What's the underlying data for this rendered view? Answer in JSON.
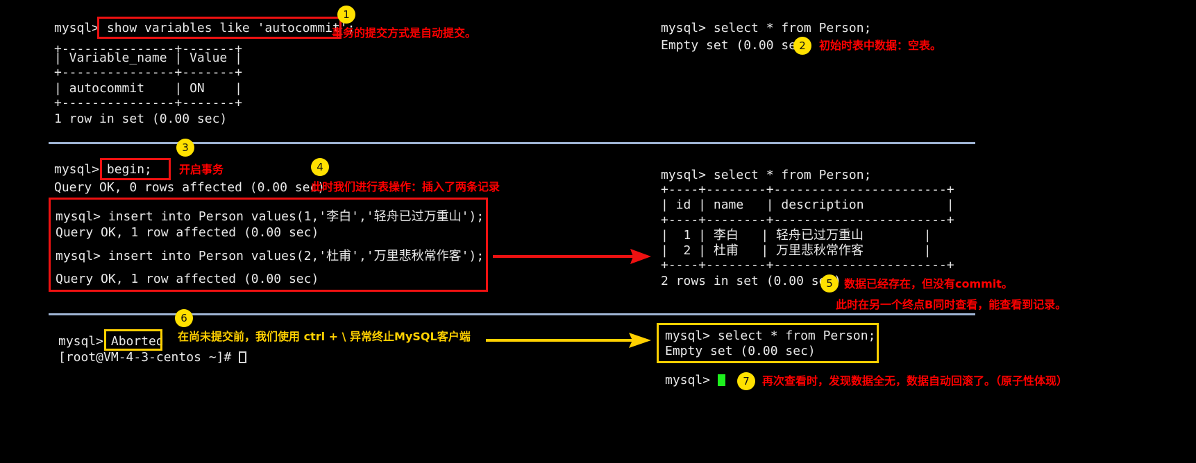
{
  "meta": {
    "accent_red": "#ff0000",
    "accent_yellow": "#ffd000",
    "badge_bg": "#ffe100",
    "terminal_bg": "#000000",
    "terminal_fg": "#e8e8e8",
    "divider_color": "#9fb4d4",
    "cursor_green": "#1ef01e"
  },
  "section1": {
    "left_terminal": {
      "prompt": "mysql> ",
      "command": "show variables like 'autocommit';",
      "lines": [
        "+---------------+-------+",
        "| Variable_name | Value |",
        "+---------------+-------+",
        "| autocommit    | ON    |",
        "+---------------+-------+",
        "1 row in set (0.00 sec)"
      ]
    },
    "right_terminal": {
      "lines": [
        "mysql> select * from Person;",
        "Empty set (0.00 sec)"
      ]
    },
    "badge1": "1",
    "anno1": "事务的提交方式是自动提交。",
    "badge2": "2",
    "anno2": "初始时表中数据：空表。"
  },
  "section2": {
    "begin_prompt": "mysql> ",
    "begin_command": "begin;",
    "begin_result": "Query OK, 0 rows affected (0.00 sec)",
    "badge3": "3",
    "anno3": "开启事务",
    "badge4": "4",
    "anno4": "此时我们进行表操作：插入了两条记录",
    "insert_block": [
      "mysql> insert into Person values(1,'李白','轻舟已过万重山');",
      "Query OK, 1 row affected (0.00 sec)",
      "",
      "mysql> insert into Person values(2,'杜甫','万里悲秋常作客');",
      "Query OK, 1 row affected (0.00 sec)"
    ],
    "right_terminal": {
      "lines": [
        "mysql> select * from Person;",
        "+----+--------+-----------------------+",
        "| id | name   | description           |",
        "+----+--------+-----------------------+",
        "|  1 | 李白   | 轻舟已过万重山        |",
        "|  2 | 杜甫   | 万里悲秋常作客        |",
        "+----+--------+-----------------------+",
        "2 rows in set (0.00 sec)"
      ]
    },
    "badge5": "5",
    "anno5_line1": "数据已经存在，但没有commit。",
    "anno5_line2": "此时在另一个终点B同时查看，能查看到记录。"
  },
  "section3": {
    "badge6": "6",
    "anno6": "在尚未提交前，我们使用 ctrl + \\ 异常终止MySQL客户端",
    "mysql_prompt": "mysql> ",
    "aborted": "Aborted",
    "shell_prompt": "[root@VM-4-3-centos ~]# ",
    "right_terminal": {
      "lines": [
        "mysql> select * from Person;",
        "Empty set (0.00 sec)"
      ]
    },
    "after_prompt": "mysql> ",
    "badge7": "7",
    "anno7": "再次查看时，发现数据全无，数据自动回滚了。（原子性体现）"
  }
}
